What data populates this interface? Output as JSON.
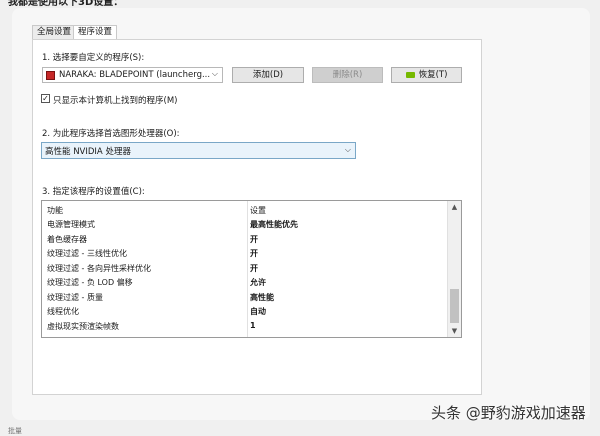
{
  "top_text": "我都是使用以下3D设置：",
  "tabs": [
    "全局设置",
    "程序设置"
  ],
  "step1": {
    "label": "1. 选择要自定义的程序(S):",
    "program": "NARAKA: BLADEPOINT (launcherg...",
    "add_button": "添加(D)",
    "remove_button": "删除(R)",
    "restore_button": "恢复(T)"
  },
  "checkbox": {
    "checked": true,
    "mark": "✓",
    "label": "只显示本计算机上找到的程序(M)"
  },
  "step2": {
    "label": "2. 为此程序选择首选图形处理器(O):",
    "gpu": "高性能 NVIDIA 处理器"
  },
  "step3": {
    "label": "3. 指定该程序的设置值(C):",
    "headers": {
      "feature": "功能",
      "setting": "设置"
    },
    "rows": [
      {
        "feature": "电源管理模式",
        "setting": "最高性能优先"
      },
      {
        "feature": "着色缓存器",
        "setting": "开"
      },
      {
        "feature": "纹理过滤 - 三线性优化",
        "setting": "开"
      },
      {
        "feature": "纹理过滤 - 各向异性采样优化",
        "setting": "开"
      },
      {
        "feature": "纹理过滤 - 负 LOD 偏移",
        "setting": "允许"
      },
      {
        "feature": "纹理过滤 - 质量",
        "setting": "高性能"
      },
      {
        "feature": "线程优化",
        "setting": "自动"
      },
      {
        "feature": "虚拟现实预渲染帧数",
        "setting": "1"
      }
    ]
  },
  "watermark": "头条 @野豹游戏加速器",
  "bottom_text": "批量"
}
